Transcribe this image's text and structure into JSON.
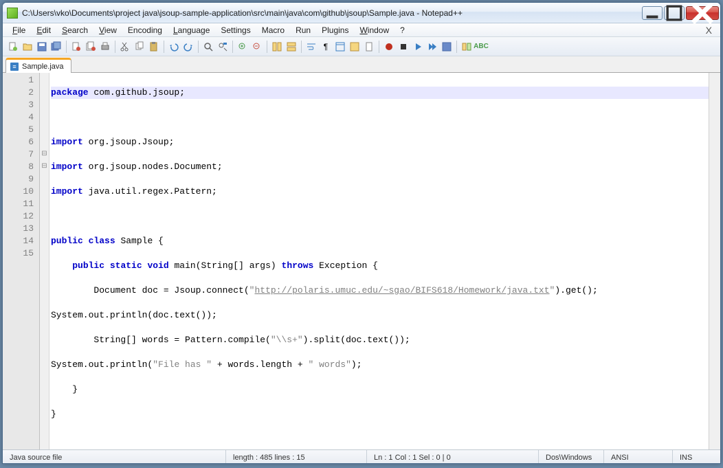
{
  "window": {
    "title": "C:\\Users\\vko\\Documents\\project java\\jsoup-sample-application\\src\\main\\java\\com\\github\\jsoup\\Sample.java - Notepad++"
  },
  "menu": {
    "items": [
      "File",
      "Edit",
      "Search",
      "View",
      "Encoding",
      "Language",
      "Settings",
      "Macro",
      "Run",
      "Plugins",
      "Window",
      "?"
    ]
  },
  "tab": {
    "label": "Sample.java"
  },
  "lines": [
    "1",
    "2",
    "3",
    "4",
    "5",
    "6",
    "7",
    "8",
    "9",
    "10",
    "11",
    "12",
    "13",
    "14",
    "15"
  ],
  "code": {
    "l1_kw": "package",
    "l1_rest": " com.github.jsoup;",
    "l3_kw": "import",
    "l3_rest": " org.jsoup.Jsoup;",
    "l4_kw": "import",
    "l4_rest": " org.jsoup.nodes.Document;",
    "l5_kw": "import",
    "l5_rest": " java.util.regex.Pattern;",
    "l7_kw1": "public",
    "l7_kw2": "class",
    "l7_rest": " Sample {",
    "l8_pad": "    ",
    "l8_kw1": "public",
    "l8_kw2": "static",
    "l8_kw3": "void",
    "l8_main": " main(String[] args) ",
    "l8_kw4": "throws",
    "l8_rest": " Exception {",
    "l9_pad": "        Document doc = Jsoup.connect(",
    "l9_q1": "\"",
    "l9_url": "http://polaris.umuc.edu/~sgao/BIFS618/Homework/java.txt",
    "l9_q2": "\"",
    "l9_rest": ").get();",
    "l10": "System.out.println(doc.text());",
    "l11_pad": "        String[] words = Pattern.compile(",
    "l11_str": "\"\\\\s+\"",
    "l11_rest": ").split(doc.text());",
    "l12_a": "System.out.println(",
    "l12_str1": "\"File has \"",
    "l12_b": " + words.length + ",
    "l12_str2": "\" words\"",
    "l12_c": ");",
    "l13": "    }",
    "l14": "}"
  },
  "status": {
    "filetype": "Java source file",
    "length": "length : 485    lines : 15",
    "position": "Ln : 1    Col : 1    Sel : 0 | 0",
    "eol": "Dos\\Windows",
    "encoding": "ANSI",
    "mode": "INS"
  }
}
